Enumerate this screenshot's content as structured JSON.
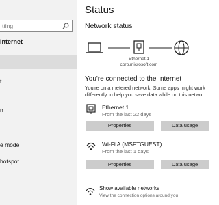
{
  "nav": {
    "search_placeholder": "tting",
    "group_title": "Internet",
    "items": [
      "t",
      "n",
      "e mode",
      "hotspot"
    ]
  },
  "content": {
    "page_title": "Status",
    "section_title": "Network status",
    "diagram": {
      "adapter_name": "Ethernet 1",
      "domain": "corp.microsoft.com"
    },
    "connected_title": "You're connected to the Internet",
    "metered_line1": "You're on a metered network. Some apps might work",
    "metered_line2": "differently to help you save data while on this netwo",
    "networks": [
      {
        "name": "Ethernet 1",
        "sub": "From the last 22 days",
        "icon": "ethernet-icon",
        "properties_label": "Properties",
        "data_usage_label": "Data usage"
      },
      {
        "name": "Wi-Fi A (MSFTGUEST)",
        "sub": "From the last 1 days",
        "icon": "wifi-icon",
        "properties_label": "Properties",
        "data_usage_label": "Data usage"
      }
    ],
    "show_networks": {
      "title": "Show available networks",
      "subtitle": "View the connection options around you",
      "icon": "available-networks-icon"
    }
  }
}
